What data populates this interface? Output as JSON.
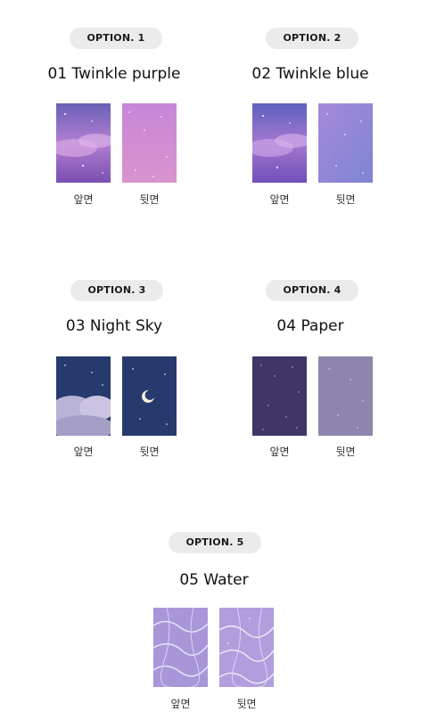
{
  "options": [
    {
      "badge": "OPTION. 1",
      "title": "01 Twinkle purple",
      "front_label": "앞면",
      "back_label": "뒷면"
    },
    {
      "badge": "OPTION. 2",
      "title": "02 Twinkle blue",
      "front_label": "앞면",
      "back_label": "뒷면"
    },
    {
      "badge": "OPTION. 3",
      "title": "03 Night Sky",
      "front_label": "앞면",
      "back_label": "뒷면"
    },
    {
      "badge": "OPTION. 4",
      "title": "04 Paper",
      "front_label": "앞면",
      "back_label": "뒷면"
    },
    {
      "badge": "OPTION. 5",
      "title": "05 Water",
      "front_label": "앞면",
      "back_label": "뒷면"
    }
  ]
}
